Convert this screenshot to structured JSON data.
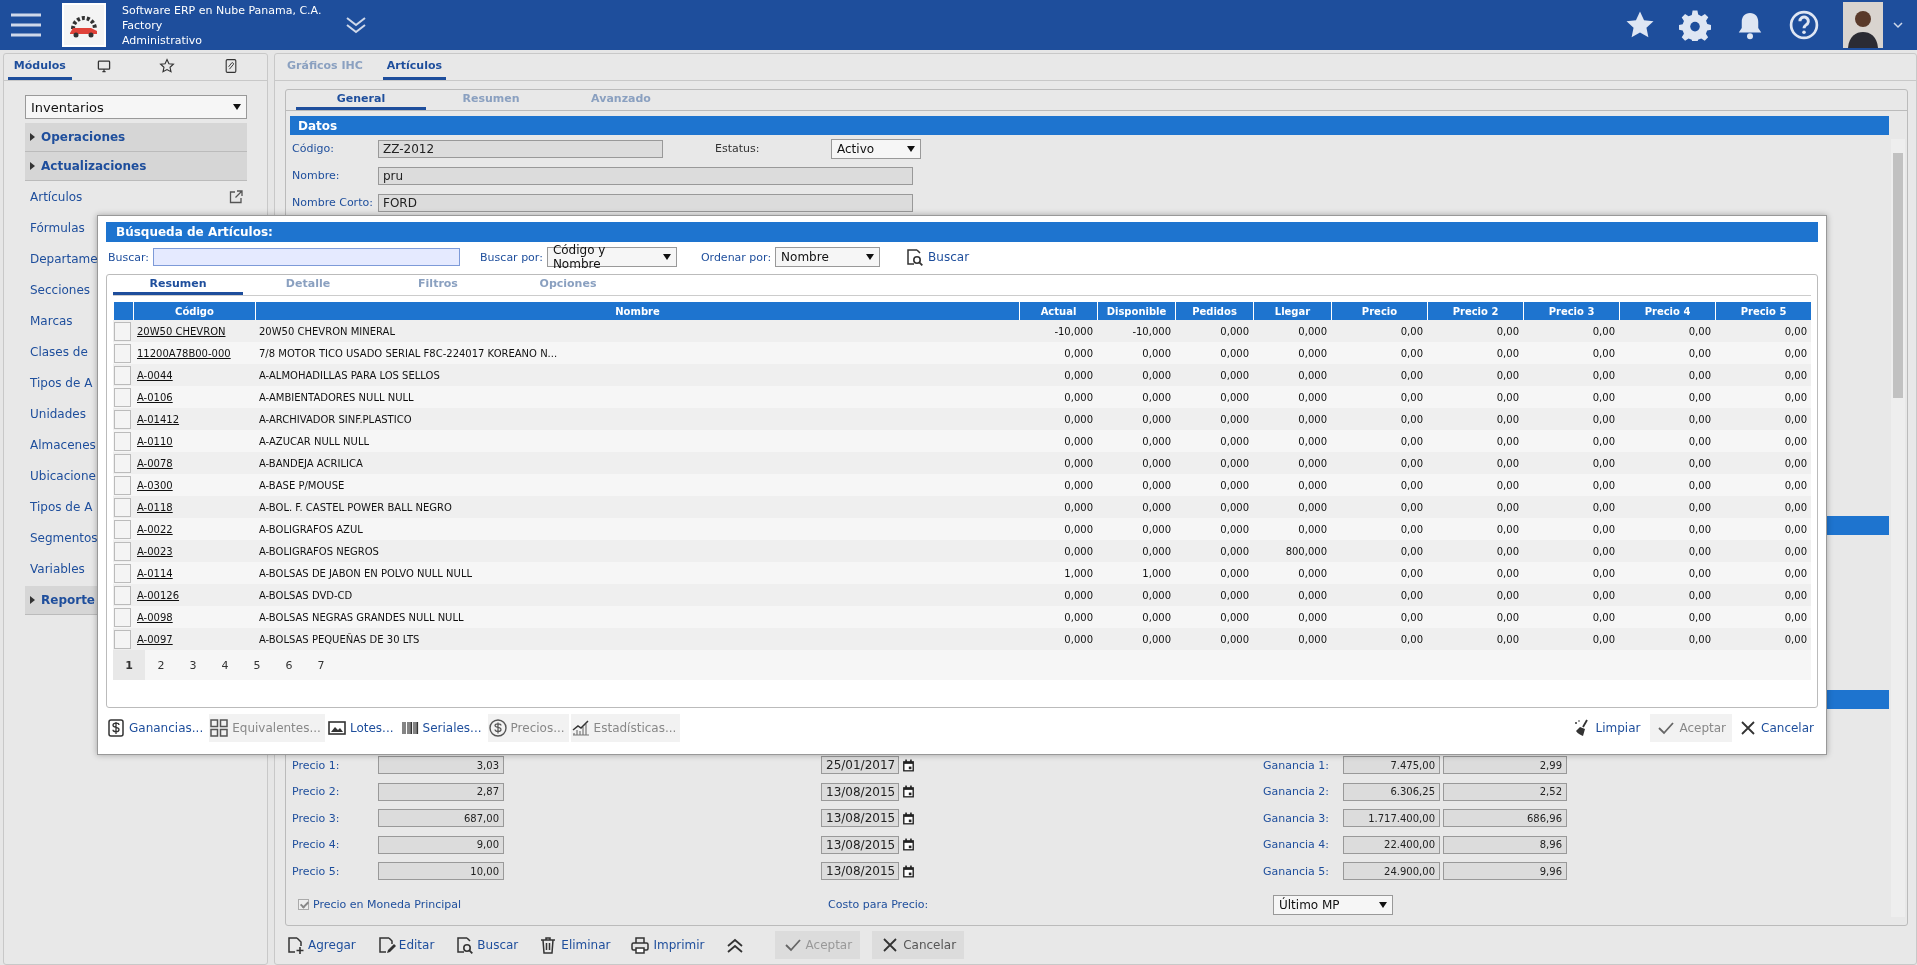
{
  "header": {
    "company": "Software ERP en Nube Panama, C.A.",
    "branch": "Factory",
    "role": "Administrativo"
  },
  "sidebar": {
    "tabs": [
      {
        "kind": "text",
        "label": "Módulos",
        "selected": true
      },
      {
        "kind": "monitor",
        "selected": false
      },
      {
        "kind": "star",
        "selected": false
      },
      {
        "kind": "clip",
        "selected": false
      }
    ],
    "module": "Inventarios",
    "menu": [
      {
        "kind": "section",
        "label": "Operaciones"
      },
      {
        "kind": "section",
        "label": "Actualizaciones"
      },
      {
        "kind": "item",
        "label": "Artículos",
        "link_icon": true
      },
      {
        "kind": "item",
        "label": "Fórmulas"
      },
      {
        "kind": "item",
        "label": "Departame"
      },
      {
        "kind": "item",
        "label": "Secciones"
      },
      {
        "kind": "item",
        "label": "Marcas"
      },
      {
        "kind": "item",
        "label": "Clases de"
      },
      {
        "kind": "item",
        "label": "Tipos de A"
      },
      {
        "kind": "item",
        "label": "Unidades"
      },
      {
        "kind": "item",
        "label": "Almacenes"
      },
      {
        "kind": "item",
        "label": "Ubicacione"
      },
      {
        "kind": "item",
        "label": "Tipos de A"
      },
      {
        "kind": "item",
        "label": "Segmentos"
      },
      {
        "kind": "item",
        "label": "Variables"
      },
      {
        "kind": "section",
        "label": "Reporte"
      }
    ]
  },
  "main": {
    "tabs": [
      {
        "label": "Gráficos IHC",
        "selected": false
      },
      {
        "label": "Artículos",
        "selected": true
      }
    ],
    "subtabs": [
      {
        "label": "General",
        "selected": true
      },
      {
        "label": "Resumen",
        "selected": false
      },
      {
        "label": "Avanzado",
        "selected": false
      }
    ],
    "section_title": "Datos",
    "codigo": {
      "label": "Código:",
      "value": "ZZ-2012"
    },
    "estatus": {
      "label": "Estatus:",
      "value": "Activo"
    },
    "nombre": {
      "label": "Nombre:",
      "value": "pru"
    },
    "nombre_corto": {
      "label": "Nombre Corto:",
      "value": "FORD"
    },
    "prices": [
      {
        "label": "Precio 1:",
        "value": "3,03",
        "date": "25/01/2017",
        "gain_label": "Ganancia 1:",
        "gain": "7.475,00",
        "gain_2": "2,99"
      },
      {
        "label": "Precio 2:",
        "value": "2,87",
        "date": "13/08/2015",
        "gain_label": "Ganancia 2:",
        "gain": "6.306,25",
        "gain_2": "2,52"
      },
      {
        "label": "Precio 3:",
        "value": "687,00",
        "date": "13/08/2015",
        "gain_label": "Ganancia 3:",
        "gain": "1.717.400,00",
        "gain_2": "686,96"
      },
      {
        "label": "Precio 4:",
        "value": "9,00",
        "date": "13/08/2015",
        "gain_label": "Ganancia 4:",
        "gain": "22.400,00",
        "gain_2": "8,96"
      },
      {
        "label": "Precio 5:",
        "value": "10,00",
        "date": "13/08/2015",
        "gain_label": "Ganancia 5:",
        "gain": "24.900,00",
        "gain_2": "9,96"
      }
    ],
    "moneda": {
      "label": "Precio en Moneda Principal",
      "checked": true,
      "disabled": true
    },
    "costo": {
      "label": "Costo para Precio:",
      "value": "Último MP"
    },
    "toolbar": [
      {
        "kind": "add",
        "label": "Agregar",
        "disabled": false
      },
      {
        "kind": "edit",
        "label": "Editar",
        "disabled": false
      },
      {
        "kind": "search",
        "label": "Buscar",
        "disabled": false
      },
      {
        "kind": "delete",
        "label": "Eliminar",
        "disabled": false
      },
      {
        "kind": "print",
        "label": "Imprimir",
        "disabled": false
      },
      {
        "kind": "collapse"
      },
      {
        "kind": "accept",
        "label": "Aceptar",
        "disabled": true
      },
      {
        "kind": "cancel",
        "label": "Cancelar",
        "disabled": false
      }
    ]
  },
  "dialog": {
    "title": "Búsqueda de Artículos:",
    "search_label": "Buscar:",
    "buscar_por": {
      "label": "Buscar por:",
      "value": "Código y Nombre"
    },
    "ordenar_por": {
      "label": "Ordenar por:",
      "value": "Nombre"
    },
    "search_button": "Buscar",
    "tabs": [
      {
        "label": "Resumen",
        "selected": true
      },
      {
        "label": "Detalle",
        "selected": false
      },
      {
        "label": "Filtros",
        "selected": false
      },
      {
        "label": "Opciones",
        "selected": false
      }
    ],
    "columns": [
      "Código",
      "Nombre",
      "Actual",
      "Disponible",
      "Pedidos",
      "Llegar",
      "Precio",
      "Precio 2",
      "Precio 3",
      "Precio 4",
      "Precio 5"
    ],
    "rows": [
      {
        "checked": false,
        "code": "20W50 CHEVRON",
        "name": "20W50 CHEVRON MINERAL",
        "values": [
          "-10,000",
          "-10,000",
          "0,000",
          "0,000",
          "0,00",
          "0,00",
          "0,00",
          "0,00",
          "0,00"
        ]
      },
      {
        "checked": false,
        "code": "11200A78B00-000",
        "name": "7/8 MOTOR TICO USADO SERIAL F8C-224017 KOREANO N...",
        "values": [
          "0,000",
          "0,000",
          "0,000",
          "0,000",
          "0,00",
          "0,00",
          "0,00",
          "0,00",
          "0,00"
        ]
      },
      {
        "checked": false,
        "code": "A-0044",
        "name": "A-ALMOHADILLAS PARA LOS SELLOS",
        "values": [
          "0,000",
          "0,000",
          "0,000",
          "0,000",
          "0,00",
          "0,00",
          "0,00",
          "0,00",
          "0,00"
        ]
      },
      {
        "checked": false,
        "code": "A-0106",
        "name": "A-AMBIENTADORES NULL NULL",
        "values": [
          "0,000",
          "0,000",
          "0,000",
          "0,000",
          "0,00",
          "0,00",
          "0,00",
          "0,00",
          "0,00"
        ]
      },
      {
        "checked": false,
        "code": "A-01412",
        "name": "A-ARCHIVADOR SINF.PLASTICO",
        "values": [
          "0,000",
          "0,000",
          "0,000",
          "0,000",
          "0,00",
          "0,00",
          "0,00",
          "0,00",
          "0,00"
        ]
      },
      {
        "checked": false,
        "code": "A-0110",
        "name": "A-AZUCAR NULL NULL",
        "values": [
          "0,000",
          "0,000",
          "0,000",
          "0,000",
          "0,00",
          "0,00",
          "0,00",
          "0,00",
          "0,00"
        ]
      },
      {
        "checked": false,
        "code": "A-0078",
        "name": "A-BANDEJA ACRILICA",
        "values": [
          "0,000",
          "0,000",
          "0,000",
          "0,000",
          "0,00",
          "0,00",
          "0,00",
          "0,00",
          "0,00"
        ]
      },
      {
        "checked": false,
        "code": "A-0300",
        "name": "A-BASE P/MOUSE",
        "values": [
          "0,000",
          "0,000",
          "0,000",
          "0,000",
          "0,00",
          "0,00",
          "0,00",
          "0,00",
          "0,00"
        ]
      },
      {
        "checked": false,
        "code": "A-0118",
        "name": "A-BOL. F. CASTEL POWER BALL NEGRO",
        "values": [
          "0,000",
          "0,000",
          "0,000",
          "0,000",
          "0,00",
          "0,00",
          "0,00",
          "0,00",
          "0,00"
        ]
      },
      {
        "checked": false,
        "code": "A-0022",
        "name": "A-BOLIGRAFOS AZUL",
        "values": [
          "0,000",
          "0,000",
          "0,000",
          "0,000",
          "0,00",
          "0,00",
          "0,00",
          "0,00",
          "0,00"
        ]
      },
      {
        "checked": false,
        "code": "A-0023",
        "name": "A-BOLIGRAFOS NEGROS",
        "values": [
          "0,000",
          "0,000",
          "0,000",
          "800,000",
          "0,00",
          "0,00",
          "0,00",
          "0,00",
          "0,00"
        ]
      },
      {
        "checked": false,
        "code": "A-0114",
        "name": "A-BOLSAS DE JABON EN POLVO NULL NULL",
        "values": [
          "1,000",
          "1,000",
          "0,000",
          "0,000",
          "0,00",
          "0,00",
          "0,00",
          "0,00",
          "0,00"
        ]
      },
      {
        "checked": false,
        "code": "A-00126",
        "name": "A-BOLSAS DVD-CD",
        "values": [
          "0,000",
          "0,000",
          "0,000",
          "0,000",
          "0,00",
          "0,00",
          "0,00",
          "0,00",
          "0,00"
        ]
      },
      {
        "checked": false,
        "code": "A-0098",
        "name": "A-BOLSAS NEGRAS GRANDES NULL NULL",
        "values": [
          "0,000",
          "0,000",
          "0,000",
          "0,000",
          "0,00",
          "0,00",
          "0,00",
          "0,00",
          "0,00"
        ]
      },
      {
        "checked": false,
        "code": "A-0097",
        "name": "A-BOLSAS PEQUEÑAS DE 30 LTS",
        "values": [
          "0,000",
          "0,000",
          "0,000",
          "0,000",
          "0,00",
          "0,00",
          "0,00",
          "0,00",
          "0,00"
        ]
      }
    ],
    "pages": [
      {
        "label": "1",
        "selected": true
      },
      {
        "label": "2",
        "selected": false
      },
      {
        "label": "3",
        "selected": false
      },
      {
        "label": "4",
        "selected": false
      },
      {
        "label": "5",
        "selected": false
      },
      {
        "label": "6",
        "selected": false
      },
      {
        "label": "7",
        "selected": false
      }
    ],
    "actions_left": [
      {
        "kind": "money",
        "label": "Ganancias...",
        "disabled": false
      },
      {
        "kind": "grid",
        "label": "Equivalentes...",
        "disabled": true
      },
      {
        "kind": "image",
        "label": "Lotes...",
        "disabled": false
      },
      {
        "kind": "barcode",
        "label": "Seriales...",
        "disabled": false
      },
      {
        "kind": "coin",
        "label": "Precios...",
        "disabled": true
      },
      {
        "kind": "chart",
        "label": "Estadísticas...",
        "disabled": true
      }
    ],
    "actions_right": [
      {
        "kind": "broom",
        "label": "Limpiar",
        "disabled": false
      },
      {
        "kind": "accept",
        "label": "Aceptar",
        "disabled": true
      },
      {
        "kind": "cancel",
        "label": "Cancelar",
        "disabled": false
      }
    ]
  }
}
